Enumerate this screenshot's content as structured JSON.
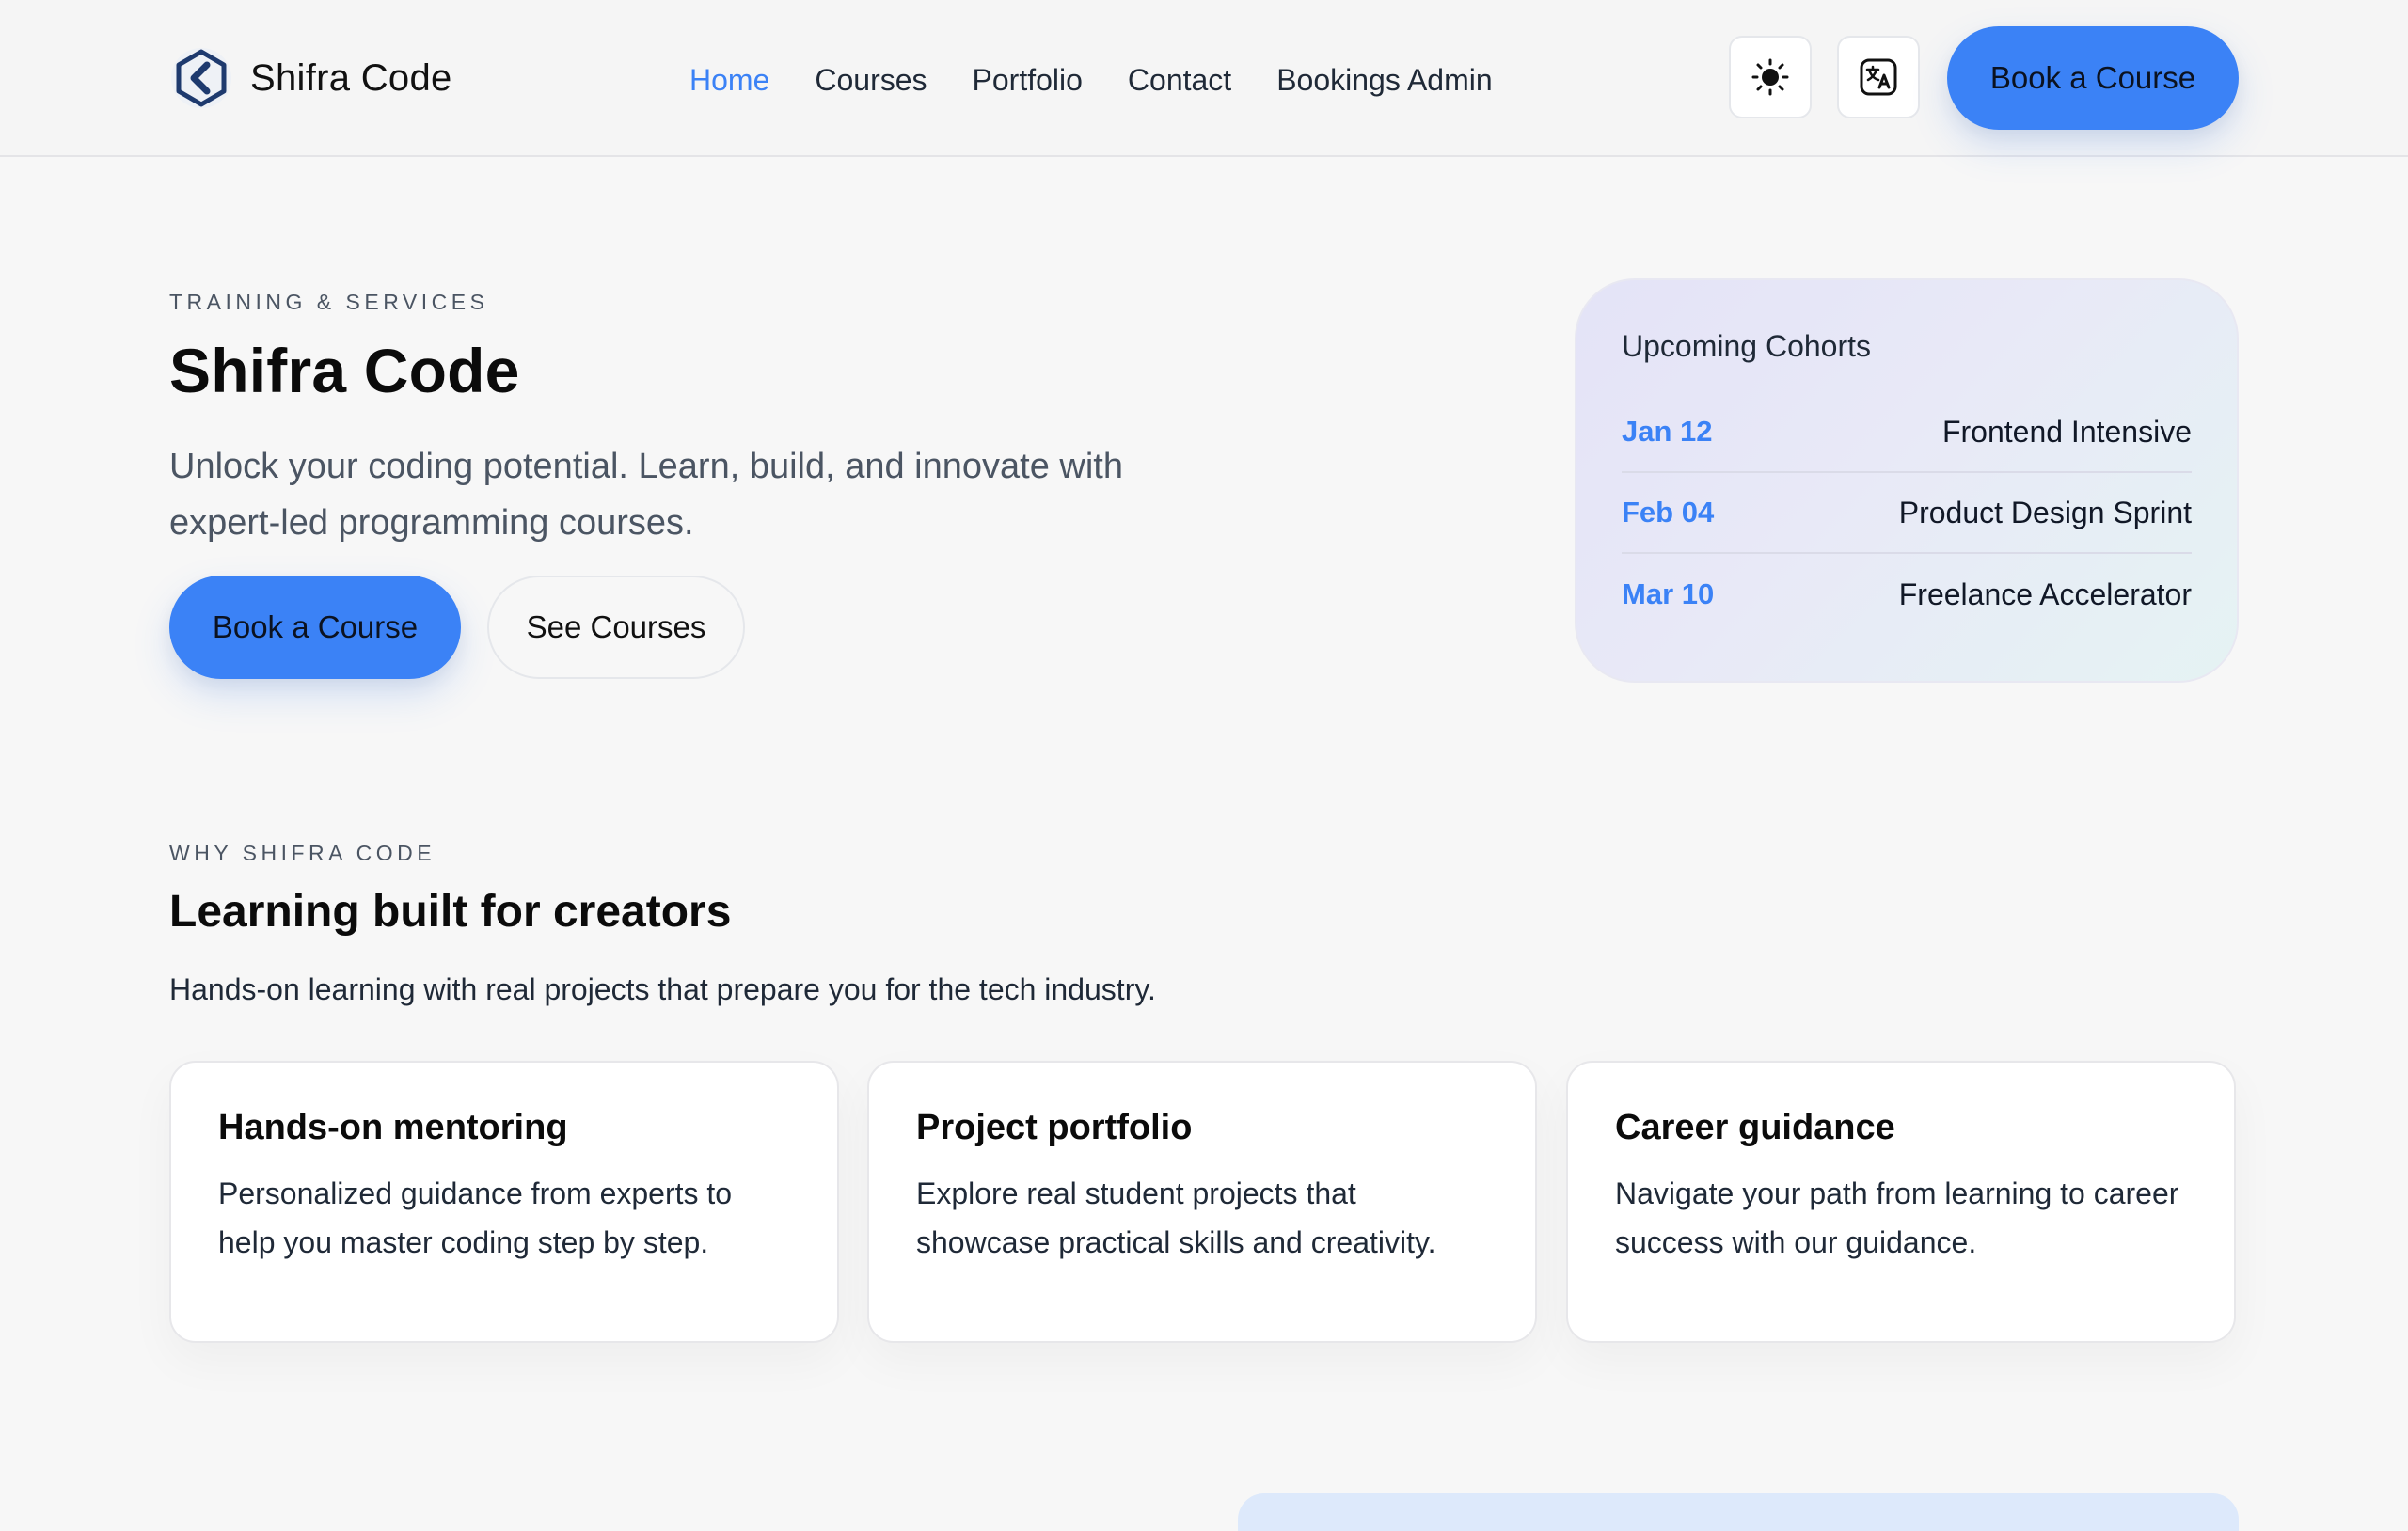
{
  "header": {
    "brand": "Shifra Code",
    "nav": [
      {
        "label": "Home",
        "active": true
      },
      {
        "label": "Courses",
        "active": false
      },
      {
        "label": "Portfolio",
        "active": false
      },
      {
        "label": "Contact",
        "active": false
      },
      {
        "label": "Bookings Admin",
        "active": false
      }
    ],
    "theme_icon": "sun-icon",
    "language_icon": "translate-icon",
    "cta_label": "Book a Course"
  },
  "hero": {
    "eyebrow": "TRAINING & SERVICES",
    "title": "Shifra Code",
    "subtitle": "Unlock your coding potential. Learn, build, and innovate with expert-led programming courses.",
    "primary_cta": "Book a Course",
    "secondary_cta": "See Courses"
  },
  "cohorts": {
    "title": "Upcoming Cohorts",
    "items": [
      {
        "date": "Jan 12",
        "name": "Frontend Intensive"
      },
      {
        "date": "Feb 04",
        "name": "Product Design Sprint"
      },
      {
        "date": "Mar 10",
        "name": "Freelance Accelerator"
      }
    ]
  },
  "why": {
    "eyebrow": "WHY SHIFRA CODE",
    "title": "Learning built for creators",
    "subtitle": "Hands-on learning with real projects that prepare you for the tech industry.",
    "cards": [
      {
        "title": "Hands-on mentoring",
        "description": "Personalized guidance from experts to help you master coding step by step."
      },
      {
        "title": "Project portfolio",
        "description": "Explore real student projects that showcase practical skills and creativity."
      },
      {
        "title": "Career guidance",
        "description": "Navigate your path from learning to career success with our guidance."
      }
    ]
  },
  "colors": {
    "accent": "#3b82f6",
    "background": "#f7f7f7",
    "logo": "#1e3a6e"
  }
}
